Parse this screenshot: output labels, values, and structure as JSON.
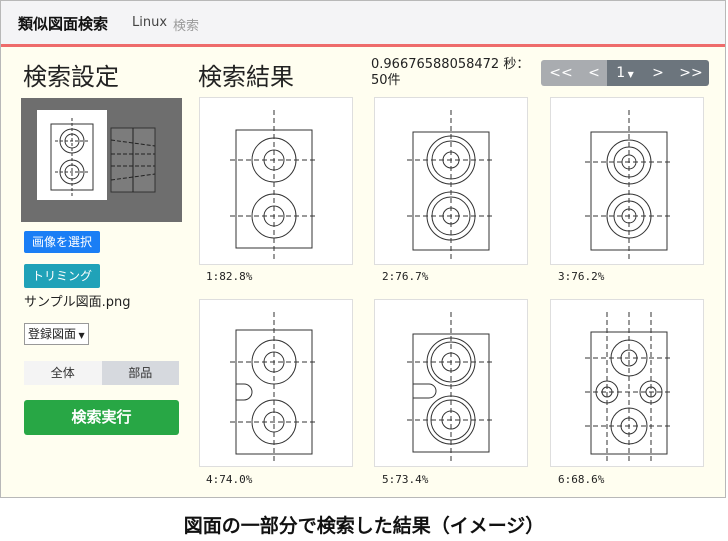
{
  "navbar": {
    "brand": "類似図面検索",
    "linux": "Linux",
    "search": "検索"
  },
  "settings": {
    "title": "検索設定",
    "select_image_label": "画像を選択",
    "trim_label": "トリミング",
    "filename": "サンプル図面.png",
    "dropdown_value": "登録図面",
    "toggle": [
      "全体",
      "部品"
    ],
    "toggle_selected": "部品",
    "run_label": "検索実行"
  },
  "results": {
    "title": "検索結果",
    "timing": "0.96676588058472 秒：50件",
    "pager": [
      "<<",
      "<",
      "1",
      ">",
      ">>"
    ],
    "items": [
      {
        "caption": "1:82.8%"
      },
      {
        "caption": "2:76.7%"
      },
      {
        "caption": "3:76.2%"
      },
      {
        "caption": "4:74.0%"
      },
      {
        "caption": "5:73.4%"
      },
      {
        "caption": "6:68.6%"
      }
    ]
  },
  "caption": "図面の一部分で検索した結果（イメージ）",
  "colors": {
    "primary": "#1a7ef5",
    "info": "#20a2b8",
    "success": "#28a745",
    "nav_accent": "#ee6b6b",
    "pager": "#6c757d"
  }
}
